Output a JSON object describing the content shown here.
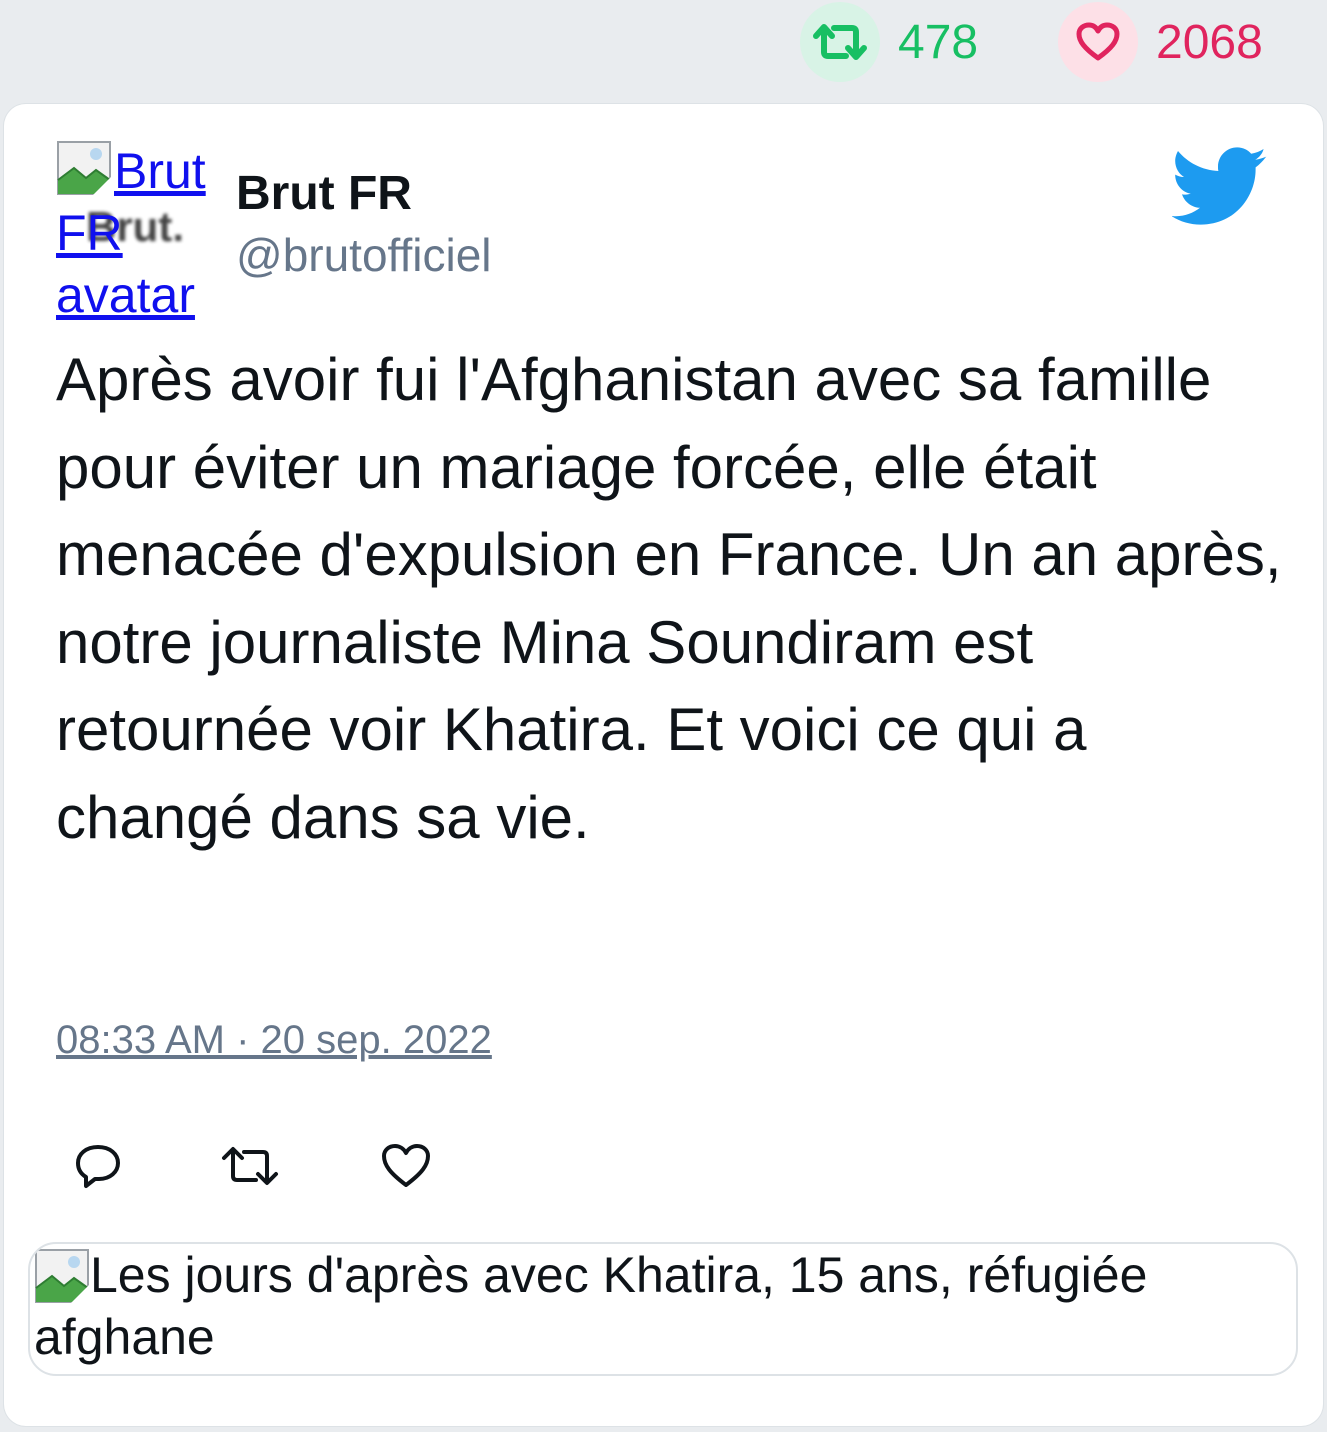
{
  "top_stats": {
    "retweet_icon": "retweet-icon",
    "retweet_count": "478",
    "like_icon": "heart-icon",
    "like_count": "2068",
    "retweet_color": "#17bf63",
    "like_color": "#e0245e"
  },
  "tweet": {
    "avatar_alt": "Brut FR avatar",
    "avatar_watermark": "Brut.",
    "author_name": "Brut FR",
    "author_handle": "@brutofficiel",
    "brand_icon": "twitter-bird-icon",
    "brand_color": "#1d9bf0",
    "text": "Après avoir fui l'Afghanistan avec sa famille pour éviter un mariage forcée, elle était menacée d'expulsion en France. Un an après, notre journaliste Mina Soundiram est retournée voir Khatira. Et voici ce qui a changé dans sa vie.",
    "timestamp": "08:33 AM · 20 sep. 2022",
    "actions": [
      {
        "name": "reply",
        "icon": "reply-icon"
      },
      {
        "name": "retweet",
        "icon": "retweet-icon"
      },
      {
        "name": "like",
        "icon": "heart-icon"
      }
    ],
    "link_card_alt": "Les jours d'après avec Khatira, 15 ans, réfugiée afghane"
  }
}
